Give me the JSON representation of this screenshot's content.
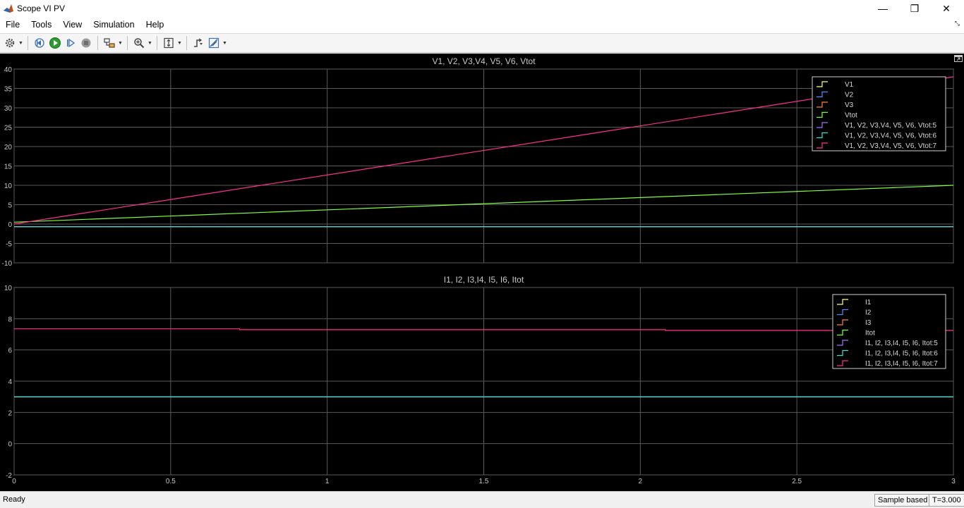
{
  "window": {
    "title": "Scope VI PV",
    "minimize_glyph": "—",
    "maximize_glyph": "❐",
    "close_glyph": "✕",
    "icon": "matlab-icon"
  },
  "menu": {
    "items": [
      "File",
      "Tools",
      "View",
      "Simulation",
      "Help"
    ]
  },
  "toolbar": {
    "buttons": [
      {
        "name": "configuration-properties-button",
        "icon": "gear-icon",
        "dropdown": true
      },
      {
        "name": "step-back-button",
        "icon": "step-back-icon"
      },
      {
        "name": "run-button",
        "icon": "play-icon"
      },
      {
        "name": "step-forward-button",
        "icon": "step-forward-icon"
      },
      {
        "name": "stop-button",
        "icon": "stop-icon"
      },
      {
        "name": "highlight-block-button",
        "icon": "highlight-icon",
        "dropdown": true
      },
      {
        "name": "zoom-button",
        "icon": "zoom-in-icon",
        "dropdown": true
      },
      {
        "name": "scale-axes-button",
        "icon": "scale-axes-icon",
        "dropdown": true
      },
      {
        "name": "triggers-button",
        "icon": "trigger-icon"
      },
      {
        "name": "cursor-measurements-button",
        "icon": "measure-icon",
        "dropdown": true
      }
    ]
  },
  "colors": {
    "background": "#000000",
    "axes_bg": "#000000",
    "grid": "#5a5a5a",
    "text": "#c8c8c8",
    "series": [
      "#ffff80",
      "#4f8fff",
      "#ff8040",
      "#80ff40",
      "#a070ff",
      "#40e0d0",
      "#ff3090"
    ]
  },
  "chart_data": [
    {
      "type": "line",
      "title": "V1, V2, V3,V4, V5, V6, Vtot",
      "xlim": [
        0,
        3
      ],
      "ylim": [
        -10,
        40
      ],
      "xticks": [
        0,
        0.5,
        1,
        1.5,
        2,
        2.5,
        3
      ],
      "xtick_labels": [
        "0",
        "0.5",
        "1",
        "1.5",
        "2",
        "2.5",
        "3"
      ],
      "show_xtick_labels": false,
      "yticks": [
        -10,
        -5,
        0,
        5,
        10,
        15,
        20,
        25,
        30,
        35,
        40
      ],
      "ytick_labels": [
        "-10",
        "-5",
        "0",
        "5",
        "10",
        "15",
        "20",
        "25",
        "30",
        "35",
        "40"
      ],
      "grid": true,
      "legend_position": "top-right",
      "series": [
        {
          "name": "V1",
          "x": [
            0,
            3
          ],
          "y": [
            -0.7,
            -0.7
          ]
        },
        {
          "name": "V2",
          "x": [
            0,
            3
          ],
          "y": [
            -0.7,
            -0.7
          ]
        },
        {
          "name": "V3",
          "x": [
            0,
            3
          ],
          "y": [
            -0.7,
            -0.7
          ]
        },
        {
          "name": "Vtot",
          "x": [
            0,
            3
          ],
          "y": [
            0.5,
            10
          ]
        },
        {
          "name": "V1, V2, V3,V4, V5, V6, Vtot:5",
          "x": [
            0,
            3
          ],
          "y": [
            -0.7,
            -0.7
          ]
        },
        {
          "name": "V1, V2, V3,V4, V5, V6, Vtot:6",
          "x": [
            0,
            3
          ],
          "y": [
            -0.7,
            -0.7
          ]
        },
        {
          "name": "V1, V2, V3,V4, V5, V6, Vtot:7",
          "x": [
            0,
            3
          ],
          "y": [
            0,
            38
          ]
        }
      ]
    },
    {
      "type": "line",
      "title": "I1, I2, I3,I4, I5, I6, Itot",
      "xlim": [
        0,
        3
      ],
      "ylim": [
        -2,
        10
      ],
      "xticks": [
        0,
        0.5,
        1,
        1.5,
        2,
        2.5,
        3
      ],
      "xtick_labels": [
        "0",
        "0.5",
        "1",
        "1.5",
        "2",
        "2.5",
        "3"
      ],
      "show_xtick_labels": true,
      "yticks": [
        -2,
        0,
        2,
        4,
        6,
        8,
        10
      ],
      "ytick_labels": [
        "-2",
        "0",
        "2",
        "4",
        "6",
        "8",
        "10"
      ],
      "grid": true,
      "legend_position": "top-right",
      "series": [
        {
          "name": "I1",
          "x": [
            0,
            3
          ],
          "y": [
            3,
            3
          ]
        },
        {
          "name": "I2",
          "x": [
            0,
            3
          ],
          "y": [
            3,
            3
          ]
        },
        {
          "name": "I3",
          "x": [
            0,
            3
          ],
          "y": [
            3,
            3
          ]
        },
        {
          "name": "Itot",
          "x": [
            0,
            3
          ],
          "y": [
            3,
            3
          ]
        },
        {
          "name": "I1, I2, I3,I4, I5, I6, Itot:5",
          "x": [
            0,
            3
          ],
          "y": [
            3,
            3
          ]
        },
        {
          "name": "I1, I2, I3,I4, I5, I6, Itot:6",
          "x": [
            0,
            3
          ],
          "y": [
            3,
            3
          ]
        },
        {
          "name": "I1, I2, I3,I4, I5, I6, Itot:7",
          "x": [
            0,
            0.72,
            0.72,
            2.08,
            2.08,
            3
          ],
          "y": [
            7.35,
            7.35,
            7.3,
            7.3,
            7.25,
            7.25
          ]
        }
      ]
    }
  ],
  "status": {
    "text": "Ready",
    "mode": "Sample based",
    "time": "T=3.000"
  }
}
